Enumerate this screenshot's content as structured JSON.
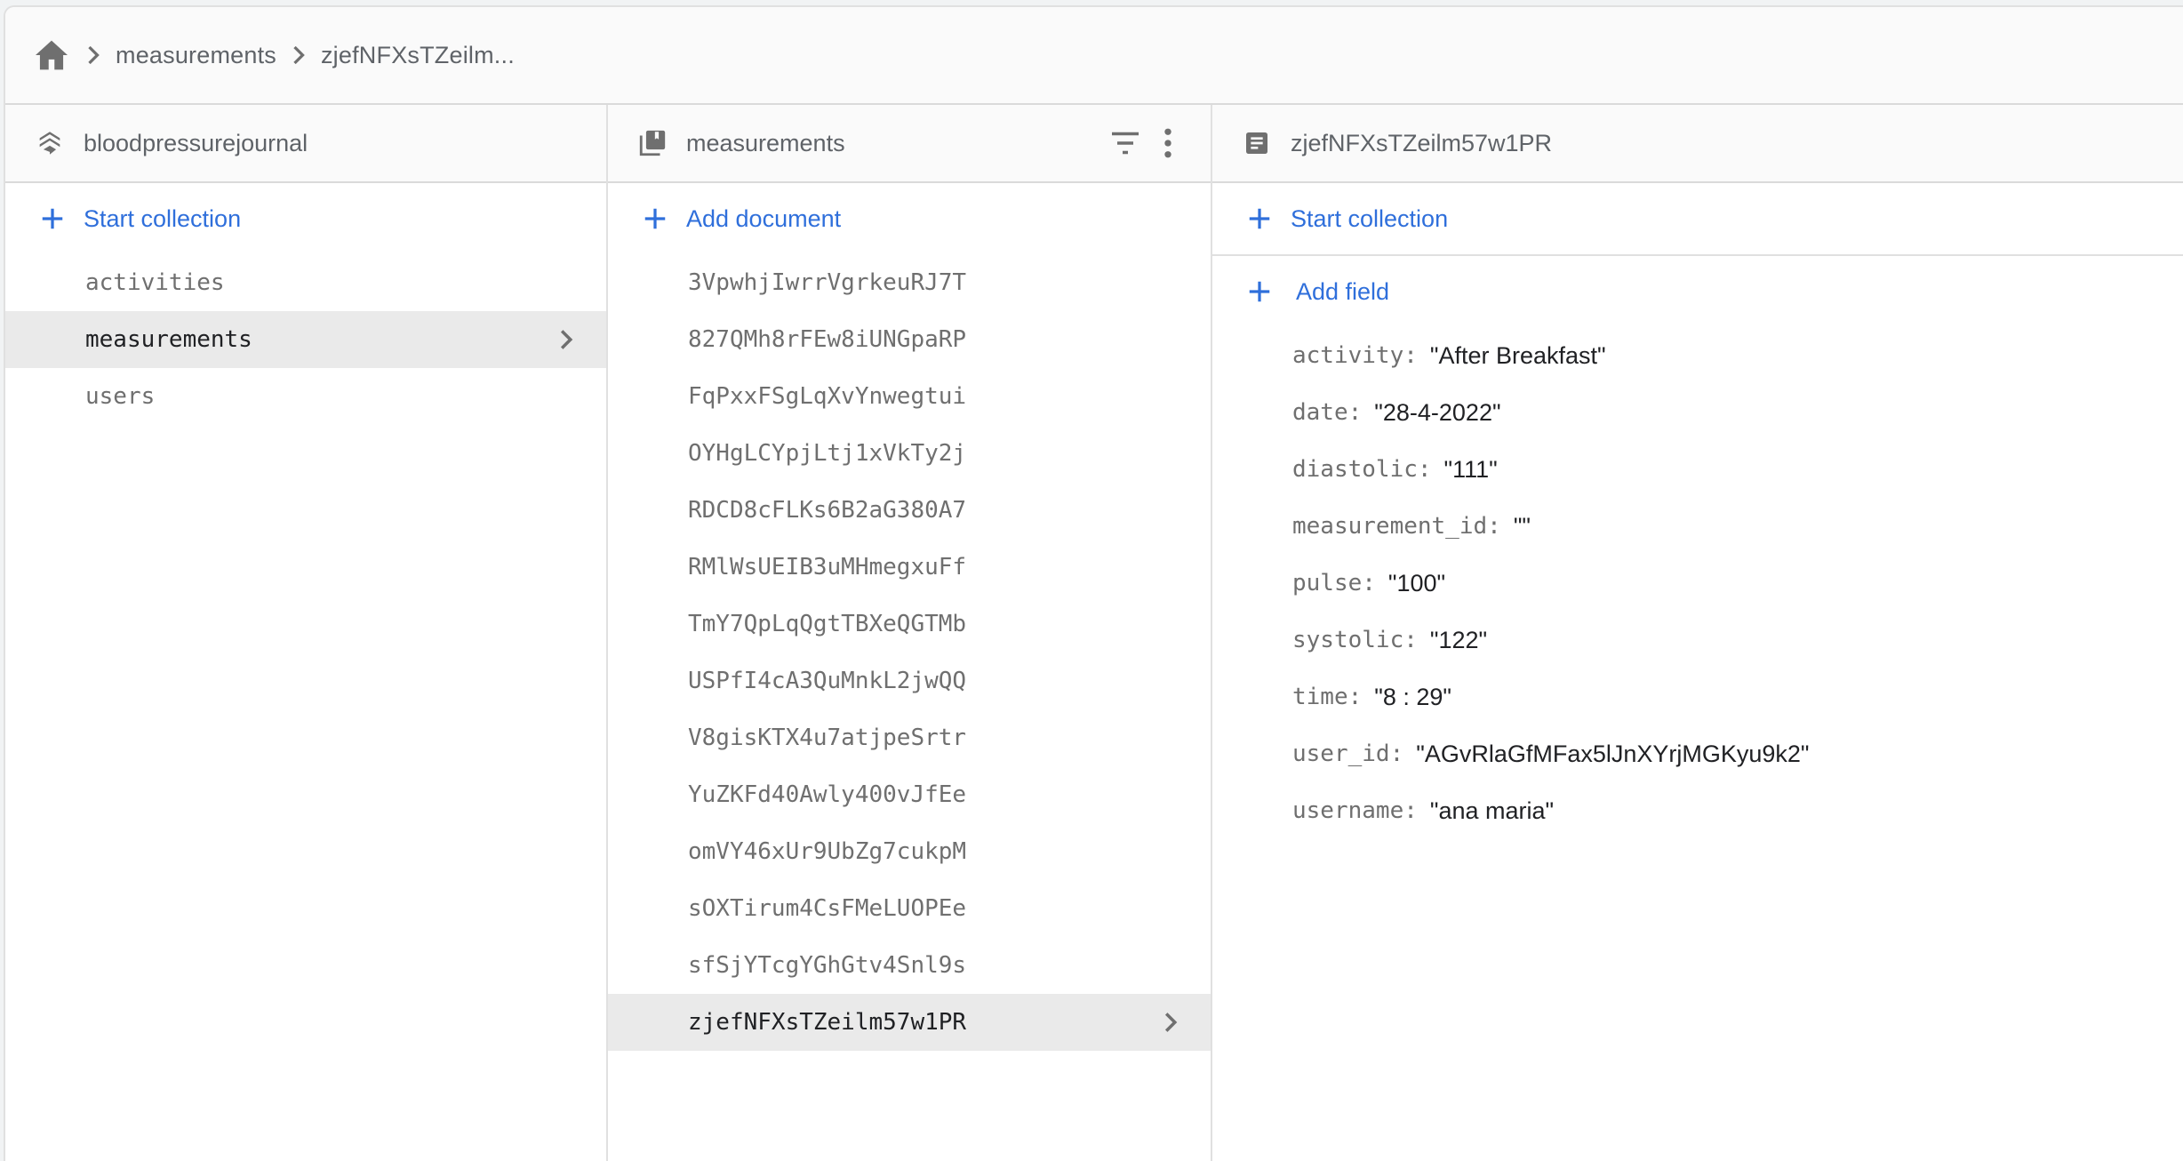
{
  "breadcrumb": {
    "home_icon": "home-icon",
    "items": [
      "measurements",
      "zjefNFXsTZeilm..."
    ]
  },
  "colors": {
    "accent": "#2f6fdb",
    "selected_bg": "#eaeaea",
    "header_bg": "#fafafa",
    "text_muted": "#5f6368",
    "text_strong": "#202124"
  },
  "root_panel": {
    "title": "bloodpressurejournal",
    "icon": "firestore-database-icon",
    "action_label": "Start collection",
    "collections": [
      {
        "label": "activities",
        "selected": false
      },
      {
        "label": "measurements",
        "selected": true
      },
      {
        "label": "users",
        "selected": false
      }
    ]
  },
  "collection_panel": {
    "title": "measurements",
    "icon": "collection-icon",
    "filter_icon": "filter-icon",
    "more_icon": "more-vert-icon",
    "action_label": "Add document",
    "documents": [
      {
        "id": "3VpwhjIwrrVgrkeuRJ7T",
        "selected": false
      },
      {
        "id": "827QMh8rFEw8iUNGpaRP",
        "selected": false
      },
      {
        "id": "FqPxxFSgLqXvYnwegtui",
        "selected": false
      },
      {
        "id": "OYHgLCYpjLtj1xVkTy2j",
        "selected": false
      },
      {
        "id": "RDCD8cFLKs6B2aG380A7",
        "selected": false
      },
      {
        "id": "RMlWsUEIB3uMHmegxuFf",
        "selected": false
      },
      {
        "id": "TmY7QpLqQgtTBXeQGTMb",
        "selected": false
      },
      {
        "id": "USPfI4cA3QuMnkL2jwQQ",
        "selected": false
      },
      {
        "id": "V8gisKTX4u7atjpeSrtr",
        "selected": false
      },
      {
        "id": "YuZKFd40Awly400vJfEe",
        "selected": false
      },
      {
        "id": "omVY46xUr9UbZg7cukpM",
        "selected": false
      },
      {
        "id": "sOXTirum4CsFMeLUOPEe",
        "selected": false
      },
      {
        "id": "sfSjYTcgYGhGtv4Snl9s",
        "selected": false
      },
      {
        "id": "zjefNFXsTZeilm57w1PR",
        "selected": true
      }
    ]
  },
  "document_panel": {
    "title": "zjefNFXsTZeilm57w1PR",
    "icon": "document-icon",
    "start_collection_label": "Start collection",
    "add_field_label": "Add field",
    "fields": [
      {
        "key": "activity:",
        "value": "\"After Breakfast\""
      },
      {
        "key": "date:",
        "value": "\"28-4-2022\""
      },
      {
        "key": "diastolic:",
        "value": "\"111\""
      },
      {
        "key": "measurement_id:",
        "value": "\"\""
      },
      {
        "key": "pulse:",
        "value": "\"100\""
      },
      {
        "key": "systolic:",
        "value": "\"122\""
      },
      {
        "key": "time:",
        "value": "\"8 : 29\""
      },
      {
        "key": "user_id:",
        "value": "\"AGvRlaGfMFax5lJnXYrjMGKyu9k2\""
      },
      {
        "key": "username:",
        "value": "\"ana maria\""
      }
    ]
  }
}
